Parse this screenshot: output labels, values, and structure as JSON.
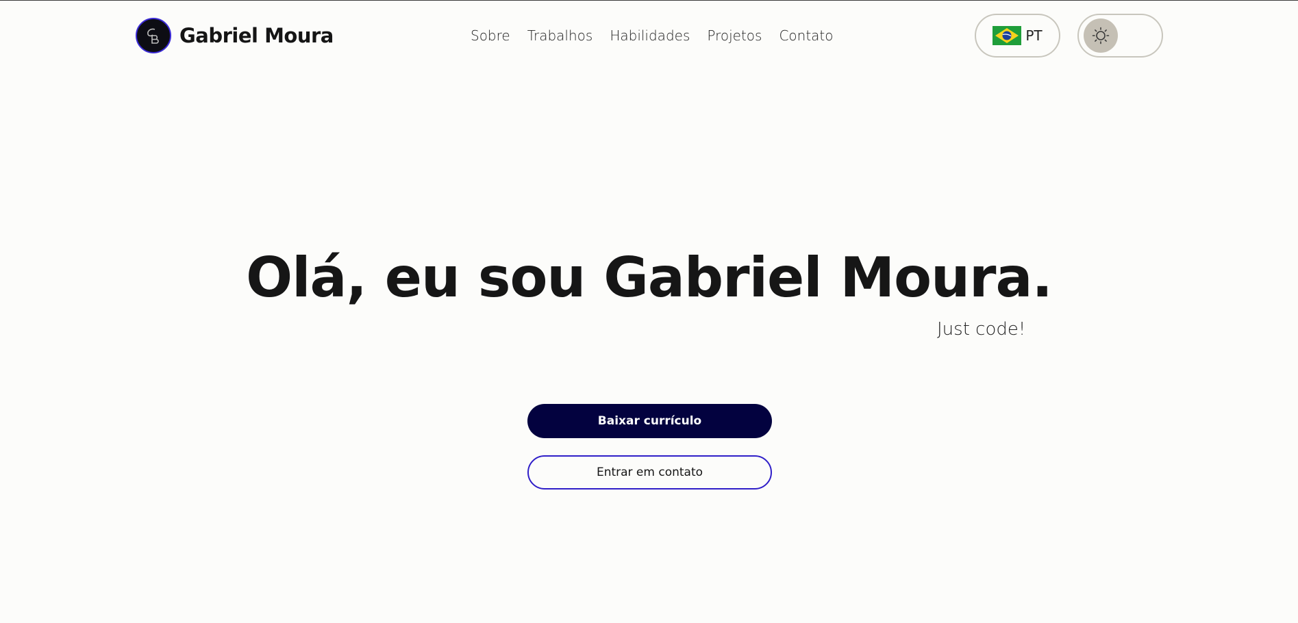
{
  "header": {
    "brand_name": "Gabriel Moura",
    "logo_monogram": "GB",
    "nav": [
      {
        "label": "Sobre"
      },
      {
        "label": "Trabalhos"
      },
      {
        "label": "Habilidades"
      },
      {
        "label": "Projetos"
      },
      {
        "label": "Contato"
      }
    ],
    "language": {
      "code": "PT",
      "flag_icon": "brazil-flag-icon"
    },
    "theme": {
      "icon": "sun-icon",
      "mode": "light"
    }
  },
  "hero": {
    "title": "Olá, eu sou Gabriel Moura.",
    "tagline": "Just code!",
    "primary_button": "Baixar currículo",
    "secondary_button": "Entrar em contato"
  },
  "colors": {
    "background": "#fcfcfa",
    "primary_button": "#03023f",
    "accent_border": "#2f1ec8",
    "toggle_knob": "#c5c0b5"
  }
}
